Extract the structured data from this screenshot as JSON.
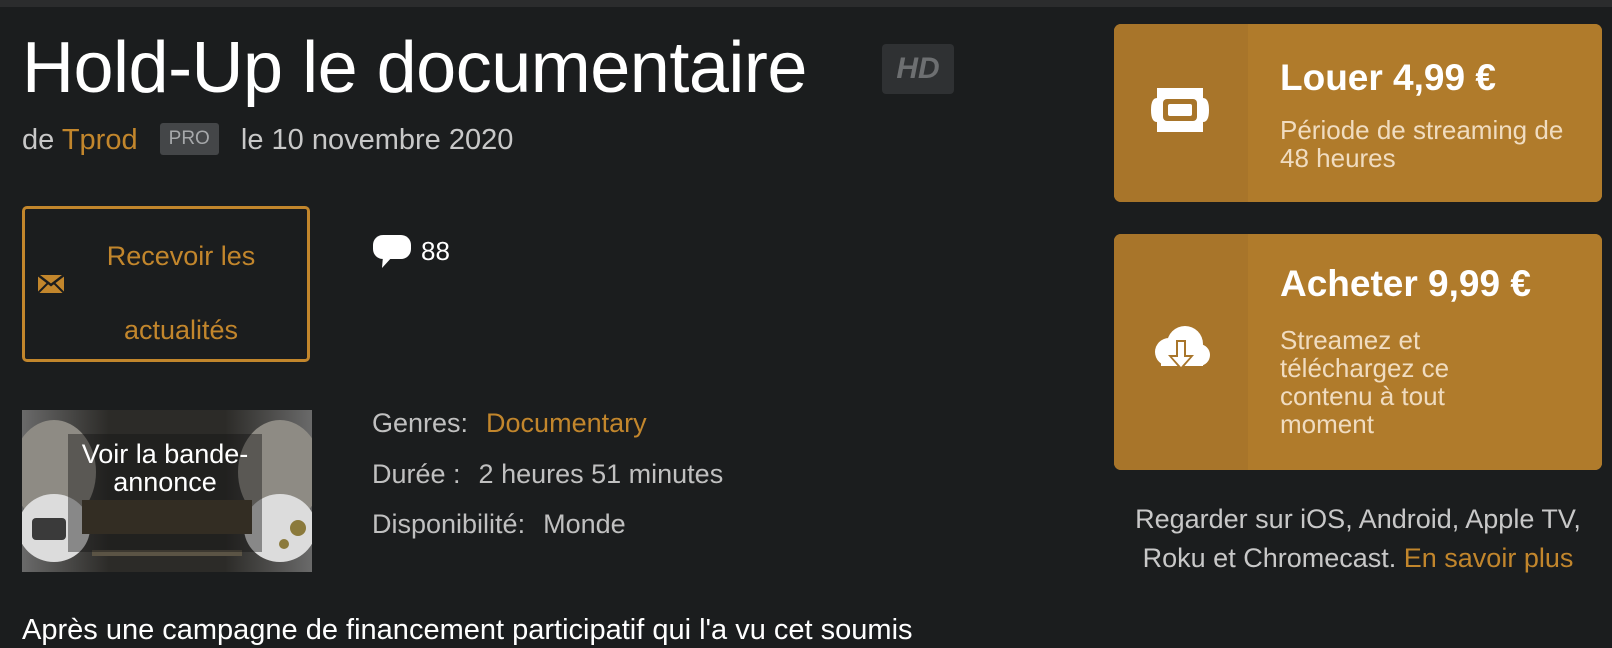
{
  "video": {
    "title": "Hold-Up le documentaire",
    "quality_badge": "HD",
    "by_prefix": "de",
    "author": "Tprod",
    "author_badge": "PRO",
    "date": "le 10 novembre 2020"
  },
  "newsletter": {
    "icon": "envelope-icon",
    "label": "Recevoir les actualités"
  },
  "comments": {
    "icon": "speech-bubble-icon",
    "count": "88"
  },
  "trailer": {
    "label": "Voir la bande-annonce"
  },
  "details": {
    "genres_label": "Genres:",
    "genres_value": "Documentary",
    "duration_label": "Durée :",
    "duration_value": "2 heures 51 minutes",
    "availability_label": "Disponibilité:",
    "availability_value": "Monde"
  },
  "offers": {
    "rent": {
      "icon": "ticket-icon",
      "title": "Louer 4,99 €",
      "description": "Période de streaming de 48 heures"
    },
    "buy": {
      "icon": "cloud-download-icon",
      "title": "Acheter 9,99 €",
      "description": "Streamez et téléchargez ce contenu à tout moment"
    }
  },
  "platforms": {
    "text": "Regarder sur iOS, Android, Apple TV, Roku et Chromecast.",
    "link": "En savoir plus"
  },
  "synopsis": {
    "partial_text": "Après une campagne de financement participatif qui l'a vu cet soumis"
  },
  "colors": {
    "background": "#1b1d1e",
    "accent": "#c2862c",
    "offer_card": "#b07b2b"
  }
}
